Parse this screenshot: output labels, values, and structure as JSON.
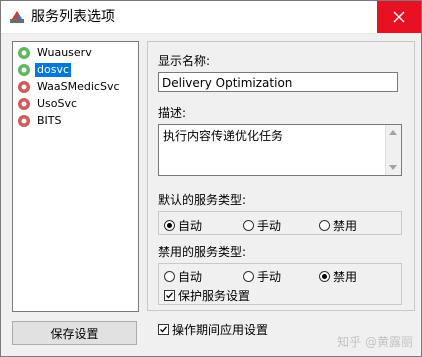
{
  "window": {
    "title": "服务列表选项",
    "close_icon": "close-icon",
    "app_icon": "app-icon"
  },
  "service_list": {
    "items": [
      {
        "label": "Wuauserv",
        "icon": "service-gear-green",
        "selected": false
      },
      {
        "label": "dosvc",
        "icon": "service-gear-green",
        "selected": true
      },
      {
        "label": "WaaSMedicSvc",
        "icon": "service-gear-red",
        "selected": false
      },
      {
        "label": "UsoSvc",
        "icon": "service-gear-red",
        "selected": false
      },
      {
        "label": "BITS",
        "icon": "service-gear-red",
        "selected": false
      }
    ]
  },
  "save_button": {
    "label": "保存设置"
  },
  "display_name": {
    "label": "显示名称:",
    "value": "Delivery Optimization"
  },
  "description": {
    "label": "描述:",
    "value": "执行内容传递优化任务"
  },
  "default_type": {
    "label": "默认的服务类型:",
    "options": [
      "自动",
      "手动",
      "禁用"
    ],
    "selected": "自动"
  },
  "disabled_type": {
    "label": "禁用的服务类型:",
    "options": [
      "自动",
      "手动",
      "禁用"
    ],
    "selected": "禁用",
    "protect_label": "保护服务设置",
    "protect_checked": true
  },
  "apply_on_run": {
    "label": "操作期间应用设置",
    "checked": true
  },
  "watermark": "知乎 @黄露丽"
}
